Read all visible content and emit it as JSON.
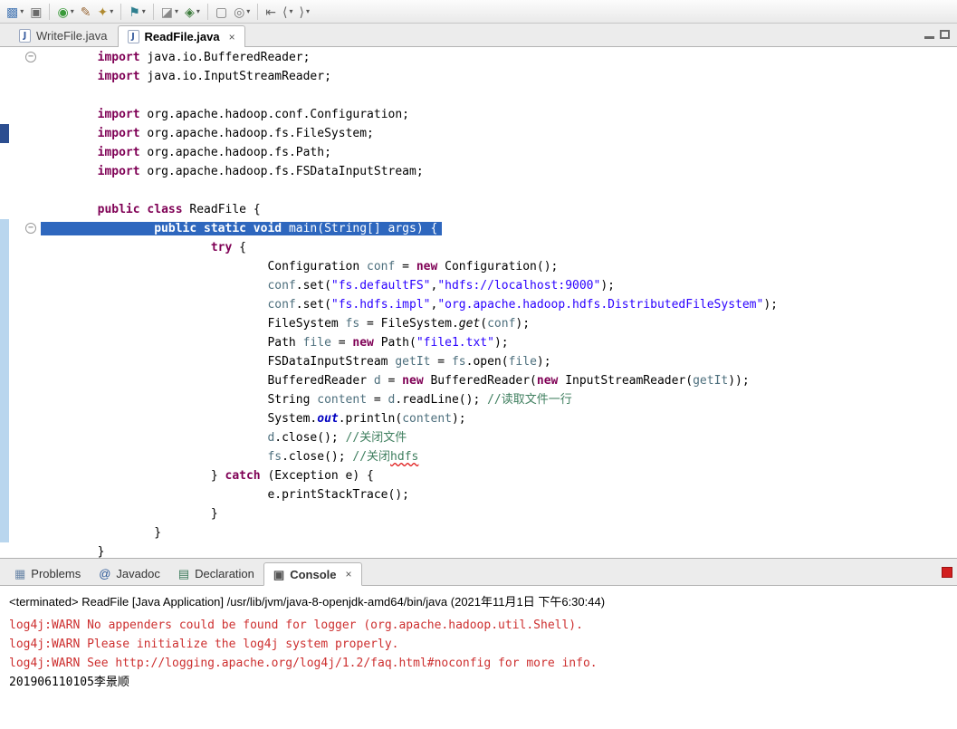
{
  "toolbar": {
    "items": [
      {
        "name": "new-wizard",
        "glyph": "▩",
        "color": "#4a7ab5",
        "dropdown": true
      },
      {
        "name": "save",
        "glyph": "▣",
        "color": "#6a6a6a"
      },
      {
        "type": "sep"
      },
      {
        "name": "run-history",
        "glyph": "◉",
        "color": "#3a9a3a",
        "dropdown": true
      },
      {
        "name": "format-paint",
        "glyph": "✎",
        "color": "#9a6a3a"
      },
      {
        "name": "external-tools",
        "glyph": "✦",
        "color": "#b08a30",
        "dropdown": true
      },
      {
        "type": "sep"
      },
      {
        "name": "debug-flag",
        "glyph": "⚑",
        "color": "#2e7f8f",
        "dropdown": true
      },
      {
        "type": "sep"
      },
      {
        "name": "new-java-project",
        "glyph": "◪",
        "color": "#888888",
        "dropdown": true
      },
      {
        "name": "new-class",
        "glyph": "◈",
        "color": "#3a7a3a",
        "dropdown": true
      },
      {
        "type": "sep"
      },
      {
        "name": "open-type",
        "glyph": "▢",
        "color": "#777777"
      },
      {
        "name": "coverage",
        "glyph": "◎",
        "color": "#777777",
        "dropdown": true
      },
      {
        "type": "sep"
      },
      {
        "name": "last-edit-location",
        "glyph": "⇤",
        "color": "#666666"
      },
      {
        "name": "back",
        "glyph": "⟨",
        "color": "#666666",
        "dropdown": true
      },
      {
        "name": "forward",
        "glyph": "⟩",
        "color": "#666666",
        "dropdown": true
      }
    ]
  },
  "editor": {
    "tabs": [
      {
        "id": "tab-writefile",
        "label": "WriteFile.java",
        "icon_letter": "J",
        "active": false,
        "closable": false
      },
      {
        "id": "tab-readfile",
        "label": "ReadFile.java",
        "icon_letter": "J",
        "active": true,
        "closable": true
      }
    ],
    "close_glyph": "×",
    "lines": [
      {
        "fold": true,
        "segs": [
          {
            "c": "p",
            "t": "        "
          },
          {
            "c": "k",
            "t": "import"
          },
          {
            "c": "p",
            "t": " java.io.BufferedReader;"
          }
        ]
      },
      {
        "segs": [
          {
            "c": "p",
            "t": "        "
          },
          {
            "c": "k",
            "t": "import"
          },
          {
            "c": "p",
            "t": " java.io.InputStreamReader;"
          }
        ]
      },
      {
        "segs": []
      },
      {
        "segs": [
          {
            "c": "p",
            "t": "        "
          },
          {
            "c": "k",
            "t": "import"
          },
          {
            "c": "p",
            "t": " org.apache.hadoop.conf.Configuration;"
          }
        ]
      },
      {
        "ann": "mark",
        "segs": [
          {
            "c": "p",
            "t": "        "
          },
          {
            "c": "k",
            "t": "import"
          },
          {
            "c": "p",
            "t": " org.apache.hadoop.fs.FileSystem;"
          }
        ]
      },
      {
        "segs": [
          {
            "c": "p",
            "t": "        "
          },
          {
            "c": "k",
            "t": "import"
          },
          {
            "c": "p",
            "t": " org.apache.hadoop.fs.Path;"
          }
        ]
      },
      {
        "segs": [
          {
            "c": "p",
            "t": "        "
          },
          {
            "c": "k",
            "t": "import"
          },
          {
            "c": "p",
            "t": " org.apache.hadoop.fs.FSDataInputStream;"
          }
        ]
      },
      {
        "segs": []
      },
      {
        "segs": [
          {
            "c": "p",
            "t": "        "
          },
          {
            "c": "k",
            "t": "public"
          },
          {
            "c": "p",
            "t": " "
          },
          {
            "c": "k",
            "t": "class"
          },
          {
            "c": "p",
            "t": " ReadFile {"
          }
        ]
      },
      {
        "fold": true,
        "sel": true,
        "ann": "range",
        "segs": [
          {
            "c": "p",
            "t": "                "
          },
          {
            "c": "k",
            "t": "public static void"
          },
          {
            "c": "p",
            "t": " main(String[] args) {"
          }
        ]
      },
      {
        "ann": "range",
        "segs": [
          {
            "c": "p",
            "t": "                        "
          },
          {
            "c": "k",
            "t": "try"
          },
          {
            "c": "p",
            "t": " {"
          }
        ]
      },
      {
        "ann": "range",
        "segs": [
          {
            "c": "p",
            "t": "                                Configuration "
          },
          {
            "c": "v",
            "t": "conf"
          },
          {
            "c": "p",
            "t": " = "
          },
          {
            "c": "k",
            "t": "new"
          },
          {
            "c": "p",
            "t": " Configuration();"
          }
        ]
      },
      {
        "ann": "range",
        "segs": [
          {
            "c": "p",
            "t": "                                "
          },
          {
            "c": "v",
            "t": "conf"
          },
          {
            "c": "p",
            "t": ".set("
          },
          {
            "c": "s",
            "t": "\"fs.defaultFS\""
          },
          {
            "c": "p",
            "t": ","
          },
          {
            "c": "s",
            "t": "\"hdfs://localhost:9000\""
          },
          {
            "c": "p",
            "t": ");"
          }
        ]
      },
      {
        "ann": "range",
        "segs": [
          {
            "c": "p",
            "t": "                                "
          },
          {
            "c": "v",
            "t": "conf"
          },
          {
            "c": "p",
            "t": ".set("
          },
          {
            "c": "s",
            "t": "\"fs.hdfs.impl\""
          },
          {
            "c": "p",
            "t": ","
          },
          {
            "c": "s",
            "t": "\"org.apache.hadoop.hdfs.DistributedFileSystem\""
          },
          {
            "c": "p",
            "t": ");"
          }
        ]
      },
      {
        "ann": "range",
        "segs": [
          {
            "c": "p",
            "t": "                                FileSystem "
          },
          {
            "c": "v",
            "t": "fs"
          },
          {
            "c": "p",
            "t": " = FileSystem."
          },
          {
            "c": "i",
            "t": "get"
          },
          {
            "c": "p",
            "t": "("
          },
          {
            "c": "v",
            "t": "conf"
          },
          {
            "c": "p",
            "t": ");"
          }
        ]
      },
      {
        "ann": "range",
        "segs": [
          {
            "c": "p",
            "t": "                                Path "
          },
          {
            "c": "v",
            "t": "file"
          },
          {
            "c": "p",
            "t": " = "
          },
          {
            "c": "k",
            "t": "new"
          },
          {
            "c": "p",
            "t": " Path("
          },
          {
            "c": "s",
            "t": "\"file1.txt\""
          },
          {
            "c": "p",
            "t": ");"
          }
        ]
      },
      {
        "ann": "range",
        "segs": [
          {
            "c": "p",
            "t": "                                FSDataInputStream "
          },
          {
            "c": "v",
            "t": "getIt"
          },
          {
            "c": "p",
            "t": " = "
          },
          {
            "c": "v",
            "t": "fs"
          },
          {
            "c": "p",
            "t": ".open("
          },
          {
            "c": "v",
            "t": "file"
          },
          {
            "c": "p",
            "t": ");"
          }
        ]
      },
      {
        "ann": "range",
        "segs": [
          {
            "c": "p",
            "t": "                                BufferedReader "
          },
          {
            "c": "v",
            "t": "d"
          },
          {
            "c": "p",
            "t": " = "
          },
          {
            "c": "k",
            "t": "new"
          },
          {
            "c": "p",
            "t": " BufferedReader("
          },
          {
            "c": "k",
            "t": "new"
          },
          {
            "c": "p",
            "t": " InputStreamReader("
          },
          {
            "c": "v",
            "t": "getIt"
          },
          {
            "c": "p",
            "t": "));"
          }
        ]
      },
      {
        "ann": "range",
        "segs": [
          {
            "c": "p",
            "t": "                                String "
          },
          {
            "c": "v",
            "t": "content"
          },
          {
            "c": "p",
            "t": " = "
          },
          {
            "c": "v",
            "t": "d"
          },
          {
            "c": "p",
            "t": ".readLine(); "
          },
          {
            "c": "c",
            "t": "//读取文件一行"
          }
        ]
      },
      {
        "ann": "range",
        "segs": [
          {
            "c": "p",
            "t": "                                System."
          },
          {
            "c": "f",
            "t": "out"
          },
          {
            "c": "p",
            "t": ".println("
          },
          {
            "c": "v",
            "t": "content"
          },
          {
            "c": "p",
            "t": ");"
          }
        ]
      },
      {
        "ann": "range",
        "segs": [
          {
            "c": "p",
            "t": "                                "
          },
          {
            "c": "v",
            "t": "d"
          },
          {
            "c": "p",
            "t": ".close(); "
          },
          {
            "c": "c",
            "t": "//关闭文件"
          }
        ]
      },
      {
        "ann": "range",
        "segs": [
          {
            "c": "p",
            "t": "                                "
          },
          {
            "c": "v",
            "t": "fs"
          },
          {
            "c": "p",
            "t": ".close(); "
          },
          {
            "c": "c",
            "t": "//关闭"
          },
          {
            "c": "cm",
            "t": "hdfs"
          }
        ]
      },
      {
        "ann": "range",
        "segs": [
          {
            "c": "p",
            "t": "                        } "
          },
          {
            "c": "k",
            "t": "catch"
          },
          {
            "c": "p",
            "t": " (Exception e) {"
          }
        ]
      },
      {
        "ann": "range",
        "segs": [
          {
            "c": "p",
            "t": "                                e.printStackTrace();"
          }
        ]
      },
      {
        "ann": "range",
        "segs": [
          {
            "c": "p",
            "t": "                        }"
          }
        ]
      },
      {
        "ann": "range",
        "segs": [
          {
            "c": "p",
            "t": "                }"
          }
        ]
      },
      {
        "segs": [
          {
            "c": "p",
            "t": "        }"
          }
        ]
      }
    ]
  },
  "console": {
    "tabs": [
      {
        "id": "tab-problems",
        "label": "Problems",
        "icon_glyph": "▦",
        "icon_color": "#6b87a8",
        "active": false
      },
      {
        "id": "tab-javadoc",
        "label": "Javadoc",
        "icon_glyph": "@",
        "icon_color": "#2b5797",
        "active": false
      },
      {
        "id": "tab-declaration",
        "label": "Declaration",
        "icon_glyph": "▤",
        "icon_color": "#3a7a5a",
        "active": false
      },
      {
        "id": "tab-console",
        "label": "Console",
        "icon_glyph": "▣",
        "icon_color": "#555555",
        "active": true,
        "closable": true
      }
    ],
    "close_glyph": "×",
    "header": "<terminated> ReadFile [Java Application] /usr/lib/jvm/java-8-openjdk-amd64/bin/java (2021年11月1日 下午6:30:44)",
    "lines": [
      {
        "stream": "stderr",
        "text": "log4j:WARN No appenders could be found for logger (org.apache.hadoop.util.Shell)."
      },
      {
        "stream": "stderr",
        "text": "log4j:WARN Please initialize the log4j system properly."
      },
      {
        "stream": "stderr",
        "text": "log4j:WARN See http://logging.apache.org/log4j/1.2/faq.html#noconfig for more info."
      },
      {
        "stream": "stdout",
        "text": "201906110105李景顺"
      }
    ]
  }
}
